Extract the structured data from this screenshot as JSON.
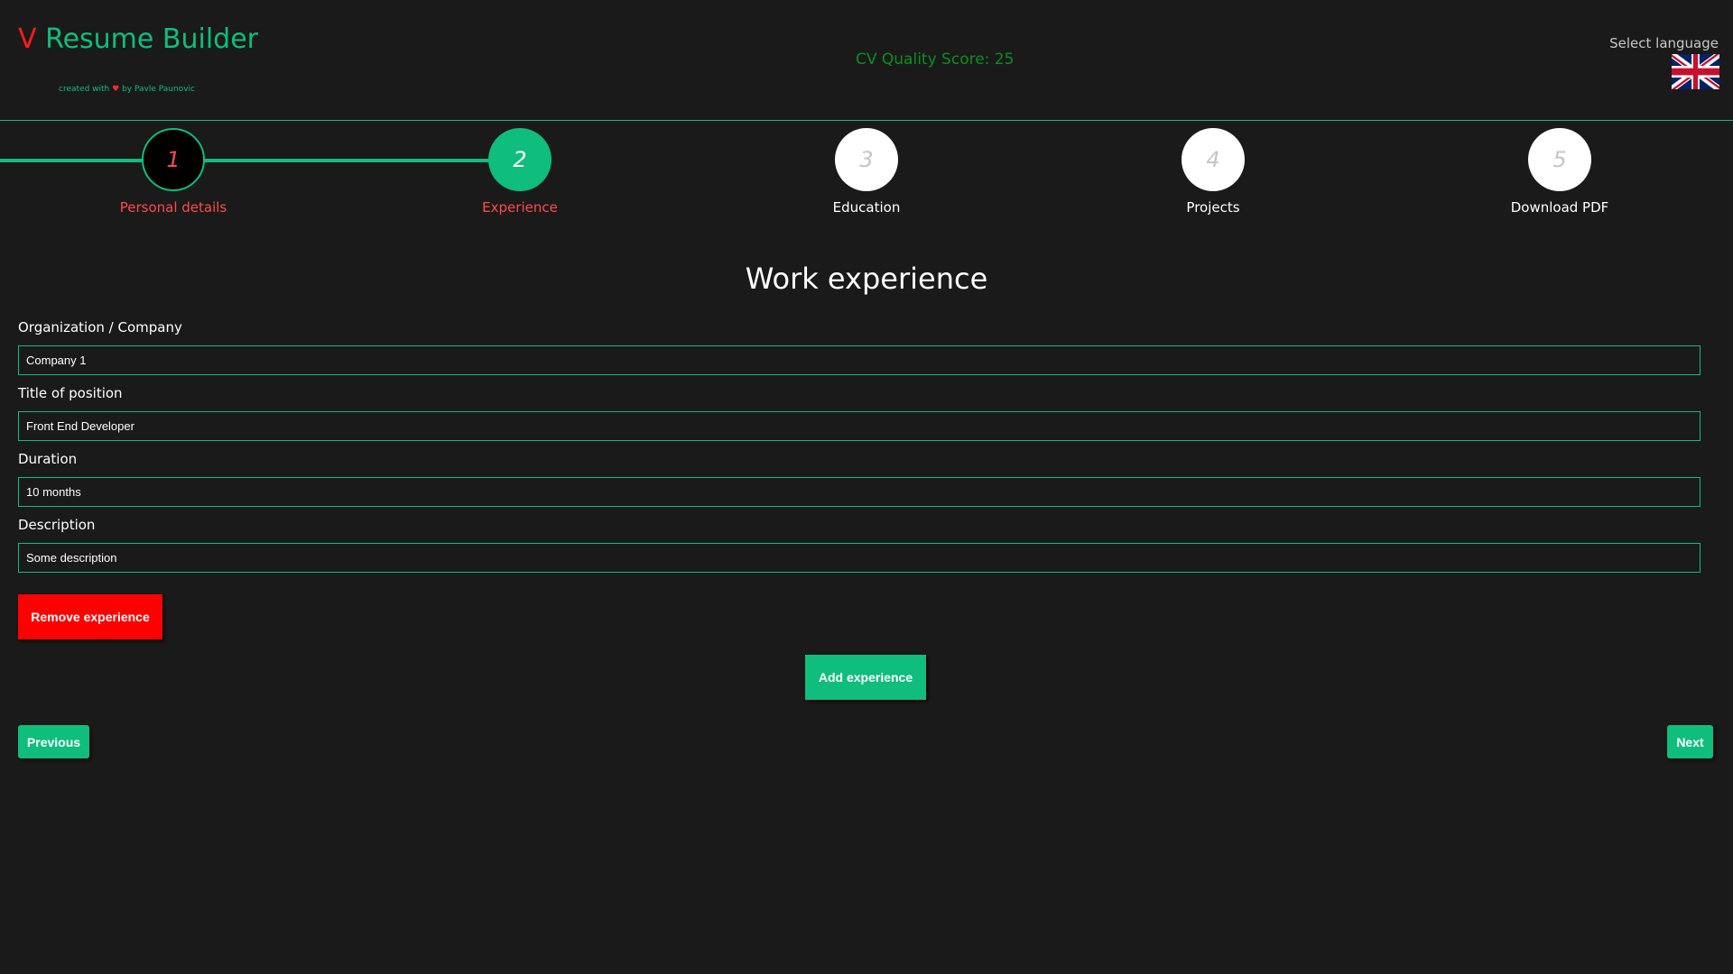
{
  "header": {
    "logo_letter": "V",
    "logo_text": "Resume Builder",
    "credit_prefix": "created with",
    "credit_heart": "♥",
    "credit_suffix": "by Pavle Paunovic",
    "quality_score": "CV Quality Score: 25",
    "language_label": "Select language",
    "language_flag_icon": "uk-flag-icon"
  },
  "stepper": {
    "steps": [
      {
        "number": "1",
        "label": "Personal details",
        "state": "done"
      },
      {
        "number": "2",
        "label": "Experience",
        "state": "active"
      },
      {
        "number": "3",
        "label": "Education",
        "state": "todo"
      },
      {
        "number": "4",
        "label": "Projects",
        "state": "todo"
      },
      {
        "number": "5",
        "label": "Download PDF",
        "state": "todo"
      }
    ]
  },
  "form": {
    "title": "Work experience",
    "organization": {
      "label": "Organization / Company",
      "value": "Company 1"
    },
    "position": {
      "label": "Title of position",
      "value": "Front End Developer"
    },
    "duration": {
      "label": "Duration",
      "value": "10 months"
    },
    "description": {
      "label": "Description",
      "value": "Some description"
    }
  },
  "buttons": {
    "remove_experience": "Remove experience",
    "add_experience": "Add experience",
    "previous": "Previous",
    "next": "Next"
  },
  "colors": {
    "background": "#1a1a1a",
    "accent": "#0fbd7d",
    "danger": "#ff0000",
    "score": "#0c8f1f"
  }
}
